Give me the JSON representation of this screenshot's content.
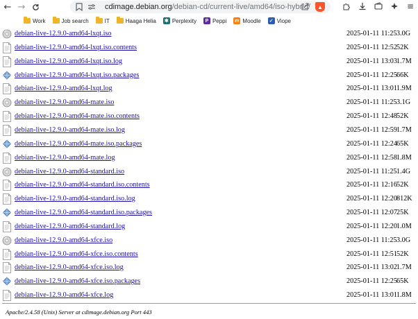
{
  "browser": {
    "url_host": "cdimage.debian.org",
    "url_path": "/debian-cd/current-live/amd64/iso-hybrid/"
  },
  "bookmarks": [
    {
      "label": "Work",
      "type": "folder"
    },
    {
      "label": "Job search",
      "type": "folder"
    },
    {
      "label": "IT",
      "type": "folder"
    },
    {
      "label": "Haaga Helia",
      "type": "folder"
    },
    {
      "label": "Perplexity",
      "type": "site",
      "icon": "perplexity-icon",
      "color": "#1f6f78"
    },
    {
      "label": "Peppi",
      "type": "site",
      "icon": "peppi-icon",
      "color": "#5a2ca0"
    },
    {
      "label": "Moodle",
      "type": "site",
      "icon": "moodle-icon",
      "color": "#f98012"
    },
    {
      "label": "Viope",
      "type": "site",
      "icon": "viope-icon",
      "color": "#2a5db0"
    }
  ],
  "files": [
    {
      "name": "debian-live-12.9.0-amd64-lxqt.iso",
      "date": "2025-01-11 11:25",
      "size": "3.0G",
      "icon": "disc-icon"
    },
    {
      "name": "debian-live-12.9.0-amd64-lxqt.iso.contents",
      "date": "2025-01-11 12:52",
      "size": "52K",
      "icon": "text-file-icon"
    },
    {
      "name": "debian-live-12.9.0-amd64-lxqt.iso.log",
      "date": "2025-01-11 13:03",
      "size": "1.7M",
      "icon": "text-file-icon"
    },
    {
      "name": "debian-live-12.9.0-amd64-lxqt.iso.packages",
      "date": "2025-01-11 12:25",
      "size": "66K",
      "icon": "package-icon"
    },
    {
      "name": "debian-live-12.9.0-amd64-lxqt.log",
      "date": "2025-01-11 13:01",
      "size": "1.9M",
      "icon": "text-file-icon"
    },
    {
      "name": "debian-live-12.9.0-amd64-mate.iso",
      "date": "2025-01-11 11:25",
      "size": "3.1G",
      "icon": "disc-icon"
    },
    {
      "name": "debian-live-12.9.0-amd64-mate.iso.contents",
      "date": "2025-01-11 12:48",
      "size": "52K",
      "icon": "text-file-icon"
    },
    {
      "name": "debian-live-12.9.0-amd64-mate.iso.log",
      "date": "2025-01-11 12:59",
      "size": "1.7M",
      "icon": "text-file-icon"
    },
    {
      "name": "debian-live-12.9.0-amd64-mate.iso.packages",
      "date": "2025-01-11 12:24",
      "size": "65K",
      "icon": "package-icon"
    },
    {
      "name": "debian-live-12.9.0-amd64-mate.log",
      "date": "2025-01-11 12:58",
      "size": "1.8M",
      "icon": "text-file-icon"
    },
    {
      "name": "debian-live-12.9.0-amd64-standard.iso",
      "date": "2025-01-11 11:25",
      "size": "1.4G",
      "icon": "disc-icon"
    },
    {
      "name": "debian-live-12.9.0-amd64-standard.iso.contents",
      "date": "2025-01-11 12:16",
      "size": "52K",
      "icon": "text-file-icon"
    },
    {
      "name": "debian-live-12.9.0-amd64-standard.iso.log",
      "date": "2025-01-11 12:20",
      "size": "812K",
      "icon": "text-file-icon"
    },
    {
      "name": "debian-live-12.9.0-amd64-standard.iso.packages",
      "date": "2025-01-11 12:07",
      "size": "25K",
      "icon": "package-icon"
    },
    {
      "name": "debian-live-12.9.0-amd64-standard.log",
      "date": "2025-01-11 12:20",
      "size": "1.0M",
      "icon": "text-file-icon"
    },
    {
      "name": "debian-live-12.9.0-amd64-xfce.iso",
      "date": "2025-01-11 11:25",
      "size": "3.0G",
      "icon": "disc-icon"
    },
    {
      "name": "debian-live-12.9.0-amd64-xfce.iso.contents",
      "date": "2025-01-11 12:51",
      "size": "52K",
      "icon": "text-file-icon"
    },
    {
      "name": "debian-live-12.9.0-amd64-xfce.iso.log",
      "date": "2025-01-11 13:02",
      "size": "1.7M",
      "icon": "text-file-icon"
    },
    {
      "name": "debian-live-12.9.0-amd64-xfce.iso.packages",
      "date": "2025-01-11 12:25",
      "size": "65K",
      "icon": "package-icon"
    },
    {
      "name": "debian-live-12.9.0-amd64-xfce.log",
      "date": "2025-01-11 13:01",
      "size": "1.8M",
      "icon": "text-file-icon"
    }
  ],
  "footer": {
    "server_signature": "Apache/2.4.58 (Unix) Server at cdimage.debian.org Port 443"
  },
  "colors": {
    "link": "#1a0dab",
    "folder": "#f0b429",
    "brave_shield": "#fb542b"
  }
}
